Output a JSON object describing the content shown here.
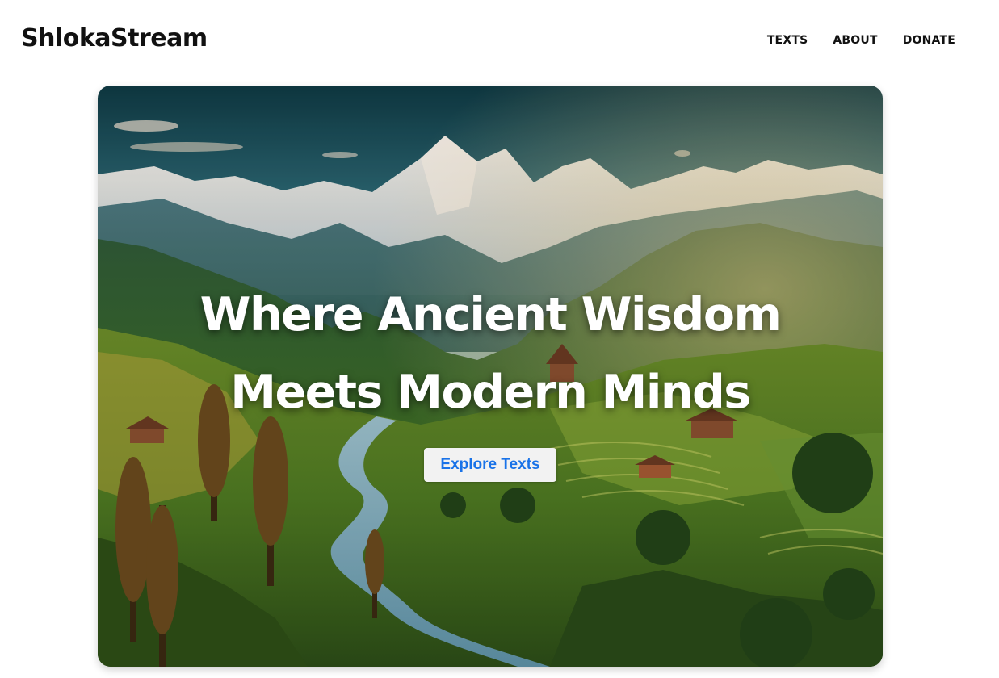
{
  "header": {
    "brand": "ShlokaStream",
    "nav": [
      {
        "label": "TEXTS"
      },
      {
        "label": "ABOUT"
      },
      {
        "label": "DONATE"
      }
    ]
  },
  "hero": {
    "title_line1": "Where Ancient Wisdom",
    "title_line2": "Meets Modern Minds",
    "cta_label": "Explore Texts",
    "image_description": "Himalayan valley landscape with snow-capped peaks, river, terraced fields and temples",
    "colors": {
      "cta_text": "#1a73e8",
      "cta_bg": "#f2f2f2",
      "title": "#ffffff"
    }
  }
}
